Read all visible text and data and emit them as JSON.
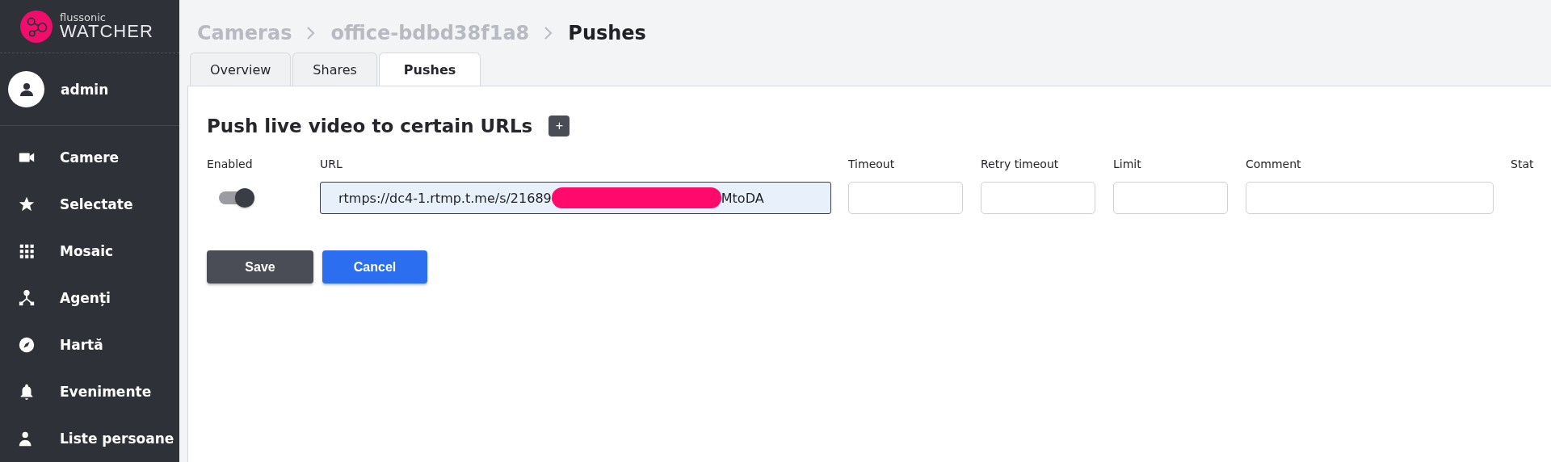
{
  "sidebar": {
    "logo": {
      "small": "flussonic",
      "large": "WATCHER"
    },
    "user": {
      "name": "admin"
    },
    "items": [
      {
        "label": "Camere",
        "kind": "camera"
      },
      {
        "label": "Selectate",
        "kind": "star"
      },
      {
        "label": "Mosaic",
        "kind": "grid"
      },
      {
        "label": "Agenți",
        "kind": "nodes"
      },
      {
        "label": "Hartă",
        "kind": "compass"
      },
      {
        "label": "Evenimente",
        "kind": "bell"
      },
      {
        "label": "Liste persoane",
        "kind": "person"
      }
    ]
  },
  "breadcrumb": [
    {
      "label": "Cameras",
      "current": false
    },
    {
      "label": "office-bdbd38f1a8",
      "current": false
    },
    {
      "label": "Pushes",
      "current": true
    }
  ],
  "tabs": [
    {
      "label": "Overview",
      "selected": false
    },
    {
      "label": "Shares",
      "selected": false
    },
    {
      "label": "Pushes",
      "selected": true
    }
  ],
  "section": {
    "title": "Push live video to certain URLs",
    "add_button": "+"
  },
  "columns": [
    "Enabled",
    "URL",
    "Timeout",
    "Retry timeout",
    "Limit",
    "Comment",
    "Stat"
  ],
  "push": {
    "enabled": true,
    "url": {
      "start": "rtmps://dc4-1.rtmp.t.me/s/21689",
      "end": "MtoDA",
      "redacted": true
    }
  },
  "buttons": [
    {
      "label": "Save",
      "kind": "secondary"
    },
    {
      "label": "Cancel",
      "kind": "primary"
    }
  ]
}
